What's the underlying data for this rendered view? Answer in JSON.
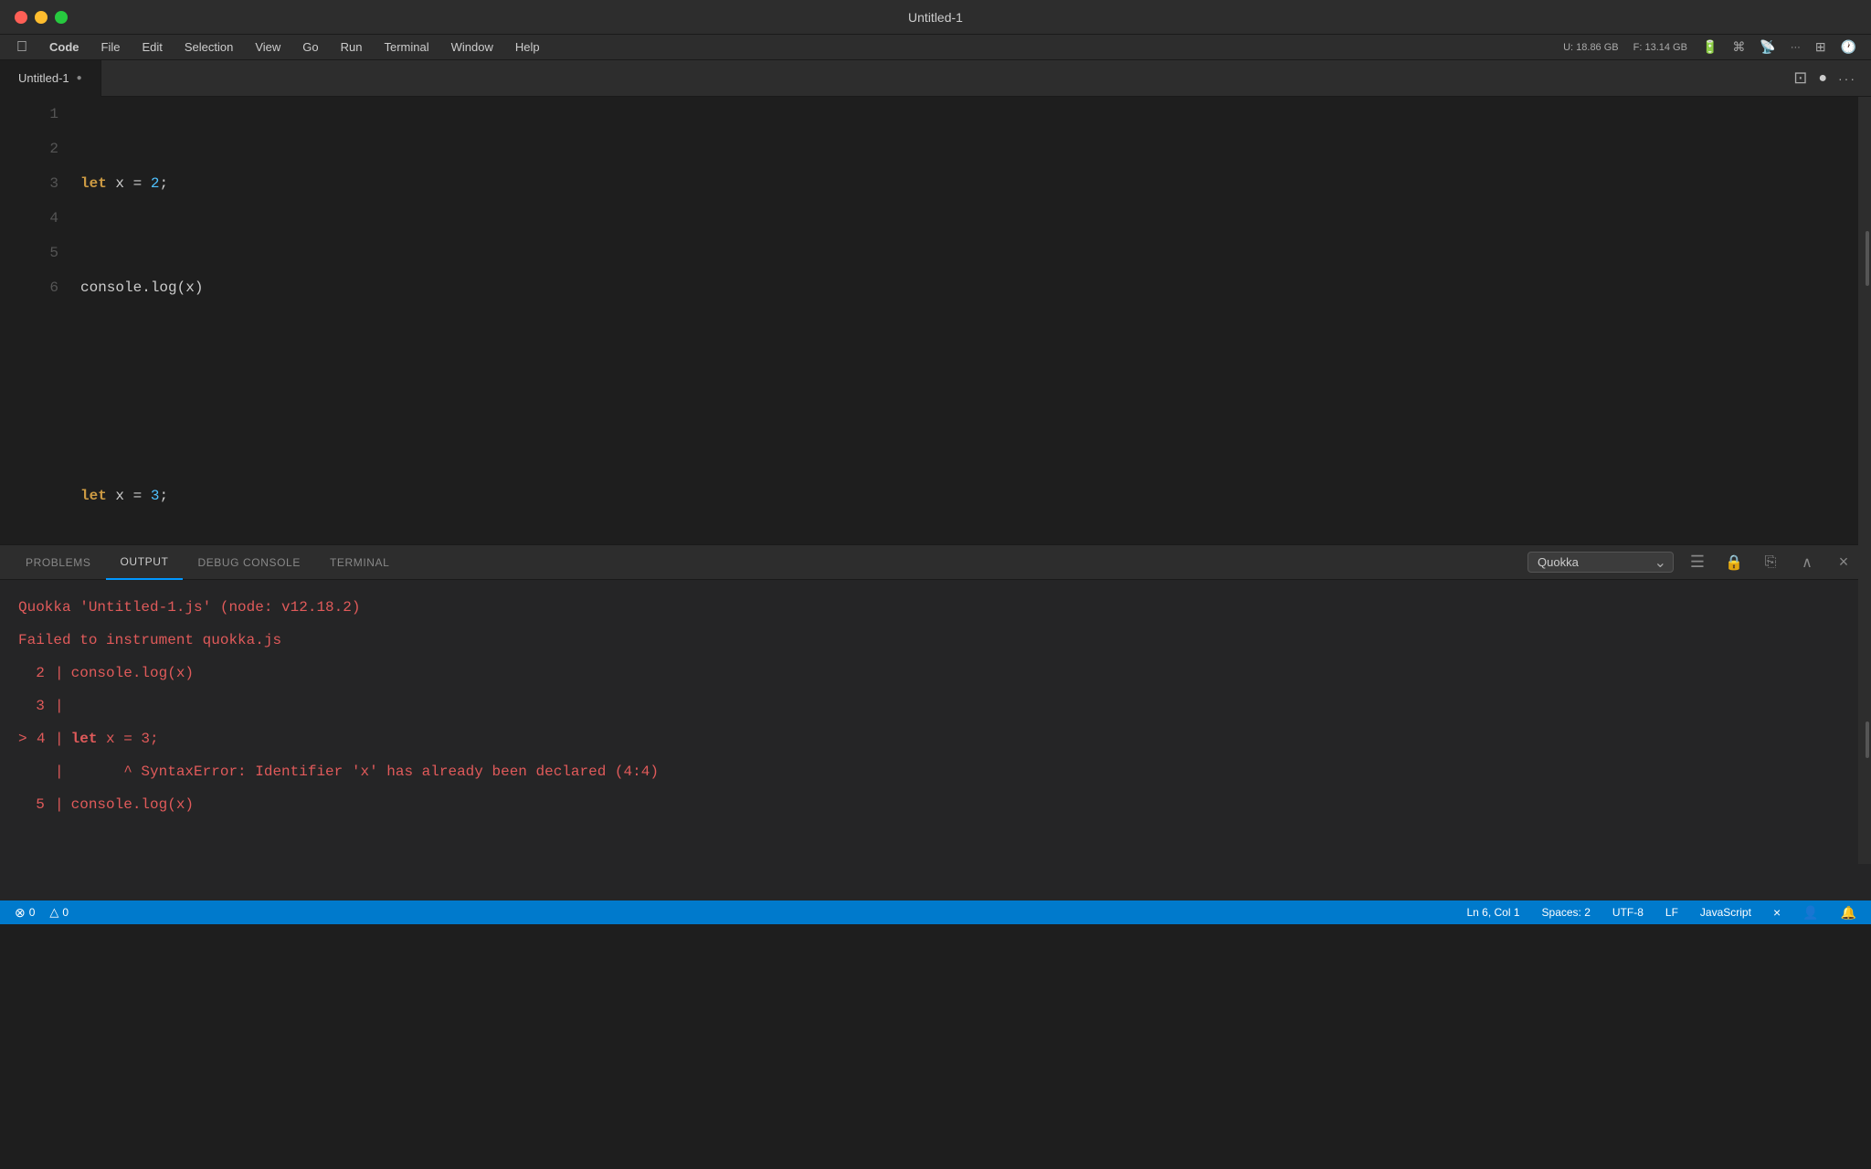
{
  "window": {
    "title": "Untitled-1"
  },
  "menubar": {
    "apple_label": "",
    "items": [
      "Code",
      "File",
      "Edit",
      "Selection",
      "View",
      "Go",
      "Run",
      "Terminal",
      "Window",
      "Help"
    ]
  },
  "sysinfo": {
    "u_label": "U:",
    "u_value": "18.86 GB",
    "f_label": "F:",
    "f_value": "13.14 GB"
  },
  "editor": {
    "tab_label": "Untitled-1",
    "lines": [
      {
        "num": "1",
        "tokens": [
          {
            "type": "kw",
            "text": "let"
          },
          {
            "type": "plain",
            "text": " x = "
          },
          {
            "type": "num",
            "text": "2"
          },
          {
            "type": "plain",
            "text": ";"
          }
        ]
      },
      {
        "num": "2",
        "tokens": [
          {
            "type": "plain",
            "text": "console.log(x)"
          }
        ]
      },
      {
        "num": "3",
        "tokens": []
      },
      {
        "num": "4",
        "tokens": [
          {
            "type": "kw",
            "text": "let"
          },
          {
            "type": "plain",
            "text": " x = "
          },
          {
            "type": "num",
            "text": "3"
          },
          {
            "type": "plain",
            "text": ";"
          }
        ]
      },
      {
        "num": "5",
        "tokens": [
          {
            "type": "plain",
            "text": "console.log(x)"
          }
        ]
      },
      {
        "num": "6",
        "tokens": []
      }
    ]
  },
  "panel": {
    "tabs": [
      "PROBLEMS",
      "OUTPUT",
      "DEBUG CONSOLE",
      "TERMINAL"
    ],
    "active_tab": "OUTPUT",
    "dropdown_label": "Quokka",
    "output_lines": [
      {
        "text": "Quokka 'Untitled-1.js' (node: v12.18.2)",
        "prefix": "",
        "indent": 0
      },
      {
        "text": "Failed to instrument quokka.js",
        "prefix": "",
        "indent": 0
      },
      {
        "text": "console.log(x)",
        "prefix": "2",
        "indent": 1
      },
      {
        "text": "",
        "prefix": "3",
        "indent": 1
      },
      {
        "text": "let x = 3;",
        "prefix": "4",
        "indent": 1,
        "arrow": true
      },
      {
        "text": "^ SyntaxError: Identifier 'x' has already been declared (4:4)",
        "prefix": "",
        "indent": 2
      },
      {
        "text": "console.log(x)",
        "prefix": "5",
        "indent": 1
      }
    ]
  },
  "statusbar": {
    "errors": "0",
    "warnings": "0",
    "position": "Ln 6, Col 1",
    "spaces": "Spaces: 2",
    "encoding": "UTF-8",
    "eol": "LF",
    "language": "JavaScript"
  },
  "icons": {
    "split_editor": "⊟",
    "dot": "●",
    "more": "···",
    "chevron_down": "⌄",
    "list_icon": "≡",
    "lock_icon": "🔒",
    "copy_icon": "⎘",
    "chevron_up": "∧",
    "close": "×",
    "error_icon": "⊗",
    "warning_icon": "△",
    "bell_icon": "🔔",
    "person_icon": "👤"
  }
}
